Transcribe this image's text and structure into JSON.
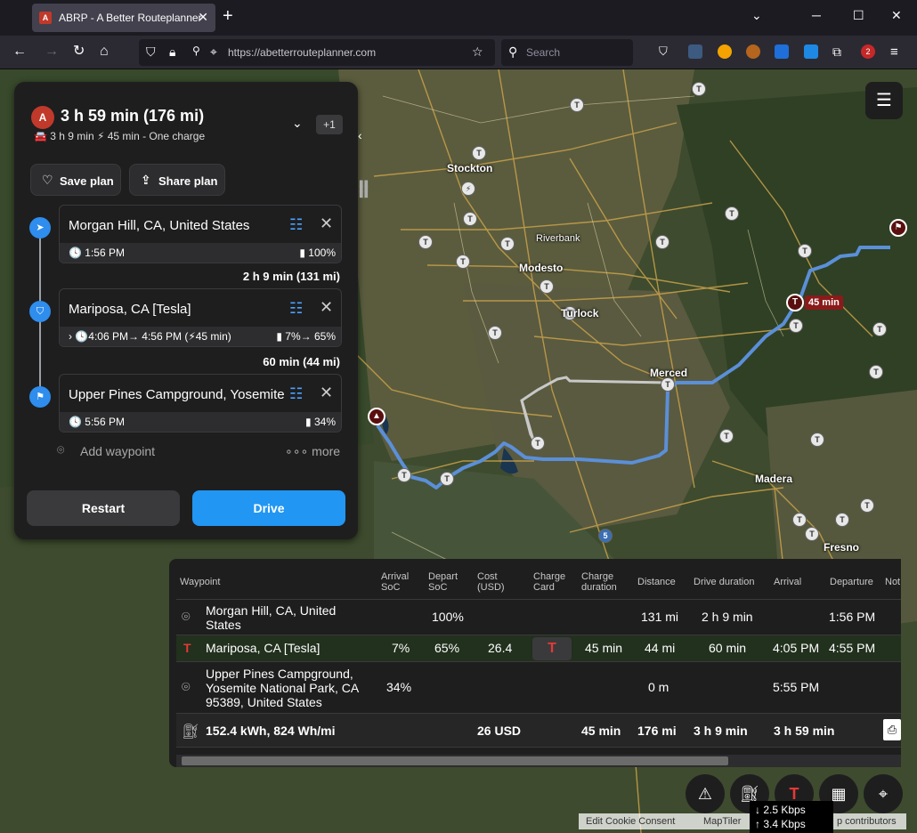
{
  "browser": {
    "tab_title": "ABRP - A Better Routeplanner",
    "tab_close": "✕",
    "new_tab": "+",
    "url": "https://abetterrouteplanner.com",
    "search_placeholder": "Search",
    "back": "←",
    "forward": "→",
    "reload": "↻",
    "home": "⌂",
    "win_min": "─",
    "win_max": "☐",
    "win_close": "✕",
    "tabs_list": "⌄",
    "ext_badge": "2"
  },
  "plan": {
    "summary": "3 h 59 min (176 mi)",
    "sub": "🚘 3 h 9 min   ⚡ 45 min - One charge",
    "alt_count": "+1",
    "save_label": "Save plan",
    "share_label": "Share plan",
    "waypoints": [
      {
        "name": "Morgan Hill, CA, United States",
        "meta_left": "🕓 1:56 PM",
        "meta_right": "▮ 100%"
      },
      {
        "name": "Mariposa, CA [Tesla]",
        "meta_left": "›  🕓4:06 PM→ 4:56 PM (⚡45 min)",
        "meta_right": "▮ 7%→ 65%"
      },
      {
        "name": "Upper Pines Campground, Yosemite National Park",
        "meta_left": "🕓 5:56 PM",
        "meta_right": "▮ 34%"
      }
    ],
    "legs": [
      "2 h 9 min (131 mi)",
      "60 min (44 mi)"
    ],
    "add_waypoint": "Add waypoint",
    "more": "∘∘∘ more",
    "restart_label": "Restart",
    "drive_label": "Drive"
  },
  "table": {
    "headers": [
      "Waypoint",
      "Arrival SoC",
      "Depart SoC",
      "Cost (USD)",
      "Charge Card",
      "Charge duration",
      "Distance",
      "Drive duration",
      "Arrival",
      "Departure",
      "Not"
    ],
    "rows": [
      {
        "waypoint": "Morgan Hill, CA, United States",
        "arr_soc": "",
        "dep_soc": "100%",
        "cost": "",
        "charge_dur": "",
        "distance": "131 mi",
        "drive_dur": "2 h 9 min",
        "arrival": "",
        "departure": "1:56 PM"
      },
      {
        "waypoint": "Mariposa, CA [Tesla]",
        "arr_soc": "7%",
        "dep_soc": "65%",
        "cost": "26.4",
        "charge_dur": "45 min",
        "distance": "44 mi",
        "drive_dur": "60 min",
        "arrival": "4:05 PM",
        "departure": "4:55 PM"
      },
      {
        "waypoint": "Upper Pines Campground, Yosemite National Park, CA 95389, United States",
        "arr_soc": "34%",
        "dep_soc": "",
        "cost": "",
        "charge_dur": "",
        "distance": "0 m",
        "drive_dur": "",
        "arrival": "5:55 PM",
        "departure": ""
      }
    ],
    "totals": {
      "energy": "152.4 kWh, 824 Wh/mi",
      "cost": "26 USD",
      "charge_dur": "45 min",
      "distance": "176 mi",
      "drive_dur": "3 h 9 min",
      "arrival": "3 h 59 min"
    }
  },
  "map": {
    "cities": [
      "Stockton",
      "Riverbank",
      "Modesto",
      "Turlock",
      "Merced",
      "Madera",
      "Fresno"
    ],
    "charger_badge": "45 min",
    "route_color": "#5b8fd8",
    "alt_route_color": "#c8c8c8"
  },
  "attribution": {
    "edit": "Edit Cookie Consent",
    "maptiler": "MapTiler",
    "osm": "p contributors"
  },
  "network": {
    "down": "↓ 2.5 Kbps",
    "up": "↑ 3.4 Kbps"
  }
}
